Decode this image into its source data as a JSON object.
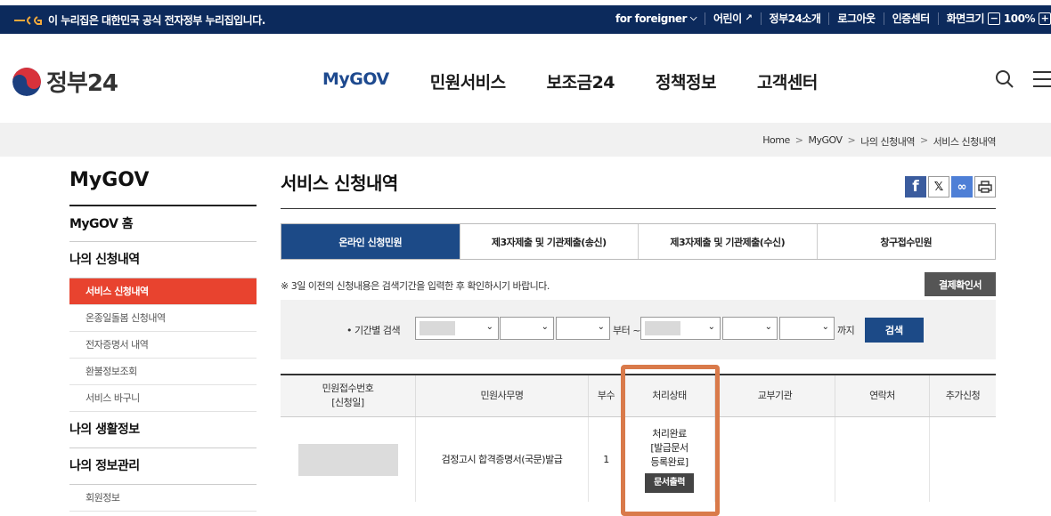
{
  "topbar": {
    "official_text": "이 누리집은 대한민국 공식 전자정부 누리집입니다.",
    "links": [
      {
        "label": "for foreigner",
        "icon": "chevron-down-icon"
      },
      {
        "label": "어린이",
        "icon": "external-link-icon"
      },
      {
        "label": "정부24소개"
      },
      {
        "label": "로그아웃"
      },
      {
        "label": "인증센터"
      },
      {
        "label": "화면크기"
      },
      {
        "label": "100%"
      }
    ]
  },
  "header": {
    "logo_text": "정부24",
    "nav": [
      "MyGOV",
      "민원서비스",
      "보조금24",
      "정책정보",
      "고객센터"
    ],
    "active_nav": "MyGOV"
  },
  "breadcrumb": [
    "Home",
    "MyGOV",
    "나의 신청내역",
    "서비스 신청내역"
  ],
  "sidebar": {
    "title": "MyGOV",
    "home": "MyGOV 홈",
    "section1": "나의 신청내역",
    "items": [
      "서비스 신청내역",
      "온종일돌봄 신청내역",
      "전자증명서 내역",
      "환불정보조회",
      "서비스 바구니"
    ],
    "section2": "나의 생활정보",
    "section3": "나의 정보관리",
    "section3_item": "회원정보"
  },
  "content": {
    "title": "서비스 신청내역",
    "share_icons": [
      "facebook-icon",
      "x-icon",
      "link-icon",
      "print-icon"
    ],
    "tabs": [
      "온라인 신청민원",
      "제3자제출 및 기관제출(송신)",
      "제3자제출 및 기관제출(수신)",
      "창구접수민원"
    ],
    "notice": "※ 3일 이전의 신청내용은 검색기간을 입력한 후 확인하시기 바랍니다.",
    "payment_button": "결제확인서",
    "filter": {
      "label": "• 기간별 검색",
      "from": "부터 ~",
      "to": "까지",
      "search": "검색"
    },
    "table": {
      "headers": [
        "민원접수번호\n[신청일]",
        "민원사무명",
        "부수",
        "처리상태",
        "교부기관",
        "연락처",
        "추가신청"
      ],
      "row": {
        "name": "검정고시 합격증명서(국문)발급",
        "count": "1",
        "status_line1": "처리완료",
        "status_line2": "[발급문서",
        "status_line3": "등록완료]",
        "print_button": "문서출력"
      }
    }
  },
  "colors": {
    "topbar": "#0c2a5c",
    "active_tab": "#1c4a87",
    "active_side": "#e8432f",
    "highlight": "#d97a4a"
  }
}
